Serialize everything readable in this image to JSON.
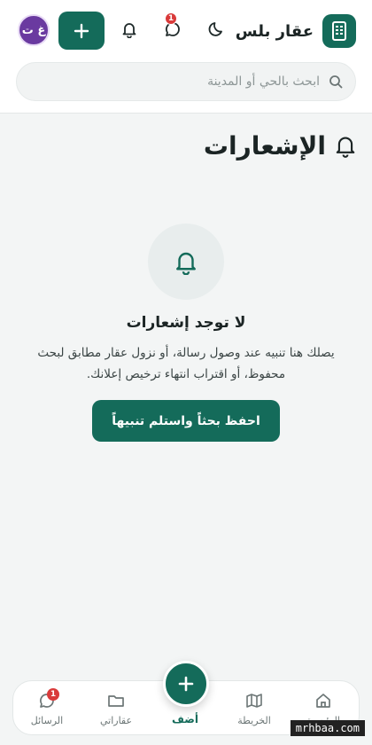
{
  "header": {
    "brand_name": "عقار بلس",
    "brand_icon": "building-icon",
    "search_placeholder": "ابحث بالحي أو المدينة",
    "messages_badge": "1",
    "avatar_initials": "غ ت",
    "accent": "#146b5a",
    "avatar_color": "#6a3aa0"
  },
  "page": {
    "title": "الإشعارات"
  },
  "empty_state": {
    "title": "لا توجد إشعارات",
    "description": "يصلك هنا تنبيه عند وصول رسالة، أو نزول عقار مطابق لبحث محفوظ، أو اقتراب انتهاء ترخيص إعلانك.",
    "cta_label": "احفظ بحثاً واستلم تنبيهاً"
  },
  "bottom_nav": {
    "items": [
      {
        "label": "الرئيسية",
        "icon": "home-icon"
      },
      {
        "label": "الخريطة",
        "icon": "map-icon"
      },
      {
        "label": "أضف",
        "icon": "plus-icon"
      },
      {
        "label": "عقاراتي",
        "icon": "folder-icon"
      },
      {
        "label": "الرسائل",
        "icon": "chat-icon",
        "badge": "1"
      }
    ]
  },
  "watermark": "mrhbaa.com"
}
